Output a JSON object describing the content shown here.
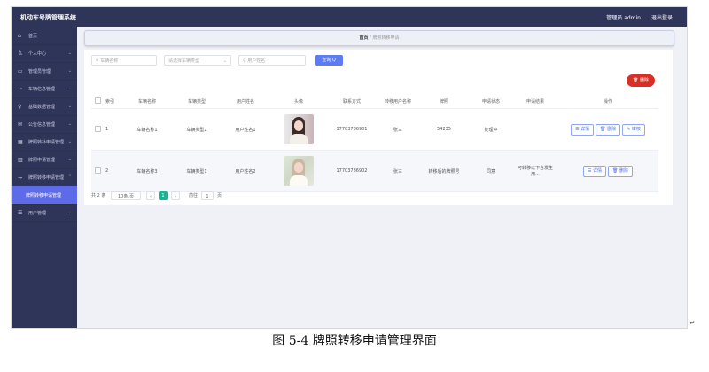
{
  "header": {
    "title": "机动车号牌管理系统",
    "admin_label": "管理员 admin",
    "logout_label": "退出登录"
  },
  "sidebar": {
    "items": [
      {
        "icon": "⌂",
        "label": "首页",
        "chevron": ""
      },
      {
        "icon": "♙",
        "label": "个人中心",
        "chevron": "⌄"
      },
      {
        "icon": "▭",
        "label": "管理员管理",
        "chevron": "⌄"
      },
      {
        "icon": "⇀",
        "label": "车辆信息管理",
        "chevron": "⌄"
      },
      {
        "icon": "♀",
        "label": "基础数据管理",
        "chevron": "⌄"
      },
      {
        "icon": "✉",
        "label": "公告信息管理",
        "chevron": "⌄"
      },
      {
        "icon": "▦",
        "label": "牌照转补申请管理",
        "chevron": "⌄"
      },
      {
        "icon": "▥",
        "label": "牌照申请管理",
        "chevron": "⌄"
      },
      {
        "icon": "⇁",
        "label": "牌照转移申请管理",
        "chevron": "⌃"
      },
      {
        "icon": "",
        "label": "牌照转移申请管理",
        "chevron": ""
      },
      {
        "icon": "☰",
        "label": "用户管理",
        "chevron": "⌄"
      }
    ]
  },
  "breadcrumb": {
    "home": "首页",
    "separator": "/",
    "current": "牌照转移申请"
  },
  "filters": {
    "vehicle_name": "车辆名称",
    "vehicle_type": "请选择车辆类型",
    "user_name": "用户姓名",
    "search_btn": "查询 Q"
  },
  "actions": {
    "delete_btn": "🗑 删除"
  },
  "table": {
    "headers": [
      "索引",
      "车辆名称",
      "车辆类型",
      "用户姓名",
      "头像",
      "联系方式",
      "转移用户名称",
      "牌照",
      "申请状态",
      "申请结果",
      "操作"
    ],
    "rows": [
      {
        "index": "1",
        "vehicle_name": "车辆名称1",
        "vehicle_type": "车辆类型2",
        "user_name": "用户姓名1",
        "phone": "17703786901",
        "transfer_user": "张三",
        "plate": "54235",
        "status": "处理中",
        "result": "",
        "ops": [
          "☰ 详情",
          "🗑 删除",
          "✎ 审核"
        ]
      },
      {
        "index": "2",
        "vehicle_name": "车辆名称3",
        "vehicle_type": "车辆类型1",
        "user_name": "用户姓名2",
        "phone": "17703786902",
        "transfer_user": "张三",
        "plate": "转移后的牌照号",
        "status": "同意",
        "result": "可转移以下含发生用...",
        "ops": [
          "☰ 详情",
          "🗑 删除"
        ]
      }
    ]
  },
  "pagination": {
    "total": "共 2 条",
    "page_size": "10条/页",
    "prev": "‹",
    "current": "1",
    "next": "›",
    "goto_label": "前往",
    "goto_value": "1",
    "page_suffix": "页"
  },
  "caption": "图 5-4 牌照转移申请管理界面",
  "paragraph_mark": "↵"
}
